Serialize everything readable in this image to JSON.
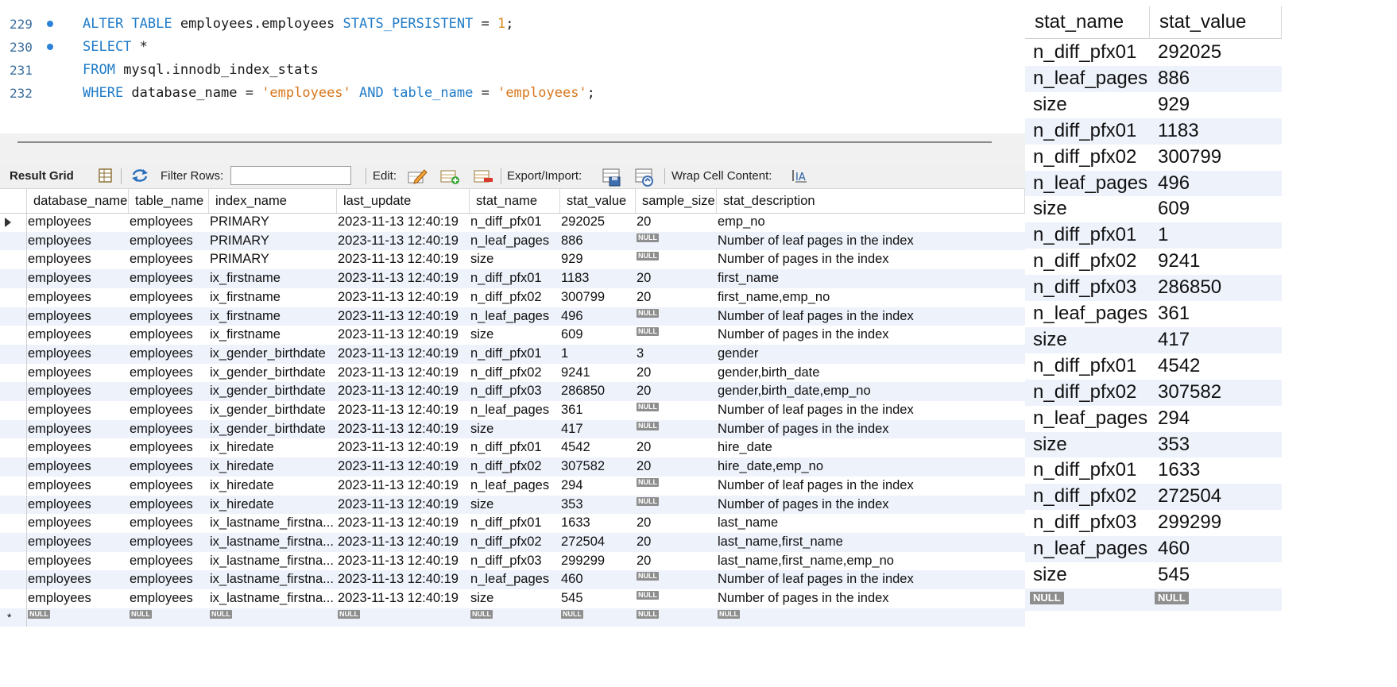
{
  "editor": {
    "lines": [
      {
        "num": "229",
        "dot": true,
        "segs": [
          {
            "t": "ALTER TABLE",
            "c": "kw"
          },
          {
            "t": " employees.employees ",
            "c": ""
          },
          {
            "t": "STATS_PERSISTENT",
            "c": "kw"
          },
          {
            "t": " = ",
            "c": ""
          },
          {
            "t": "1",
            "c": "num"
          },
          {
            "t": ";",
            "c": ""
          }
        ]
      },
      {
        "num": "230",
        "dot": true,
        "segs": [
          {
            "t": "SELECT",
            "c": "kw"
          },
          {
            "t": " *",
            "c": ""
          }
        ]
      },
      {
        "num": "231",
        "dot": false,
        "segs": [
          {
            "t": "FROM",
            "c": "kw"
          },
          {
            "t": " mysql.innodb_index_stats",
            "c": ""
          }
        ]
      },
      {
        "num": "232",
        "dot": false,
        "segs": [
          {
            "t": "WHERE",
            "c": "kw"
          },
          {
            "t": " database_name = ",
            "c": ""
          },
          {
            "t": "'employees'",
            "c": "str"
          },
          {
            "t": " ",
            "c": ""
          },
          {
            "t": "AND",
            "c": "kw"
          },
          {
            "t": " ",
            "c": ""
          },
          {
            "t": "table_name",
            "c": "kw"
          },
          {
            "t": " = ",
            "c": ""
          },
          {
            "t": "'employees'",
            "c": "str"
          },
          {
            "t": ";",
            "c": ""
          }
        ]
      }
    ]
  },
  "toolbar": {
    "result_grid": "Result Grid",
    "filter_rows": "Filter Rows:",
    "filter_value": "",
    "edit": "Edit:",
    "export_import": "Export/Import:",
    "wrap_cell": "Wrap Cell Content:"
  },
  "grid": {
    "columns": [
      "database_name",
      "table_name",
      "index_name",
      "last_update",
      "stat_name",
      "stat_value",
      "sample_size",
      "stat_description"
    ],
    "null_label": "NULL",
    "new_row_marker": "*",
    "rows": [
      [
        "employees",
        "employees",
        "PRIMARY",
        "2023-11-13 12:40:19",
        "n_diff_pfx01",
        "292025",
        "20",
        "emp_no"
      ],
      [
        "employees",
        "employees",
        "PRIMARY",
        "2023-11-13 12:40:19",
        "n_leaf_pages",
        "886",
        null,
        "Number of leaf pages in the index"
      ],
      [
        "employees",
        "employees",
        "PRIMARY",
        "2023-11-13 12:40:19",
        "size",
        "929",
        null,
        "Number of pages in the index"
      ],
      [
        "employees",
        "employees",
        "ix_firstname",
        "2023-11-13 12:40:19",
        "n_diff_pfx01",
        "1183",
        "20",
        "first_name"
      ],
      [
        "employees",
        "employees",
        "ix_firstname",
        "2023-11-13 12:40:19",
        "n_diff_pfx02",
        "300799",
        "20",
        "first_name,emp_no"
      ],
      [
        "employees",
        "employees",
        "ix_firstname",
        "2023-11-13 12:40:19",
        "n_leaf_pages",
        "496",
        null,
        "Number of leaf pages in the index"
      ],
      [
        "employees",
        "employees",
        "ix_firstname",
        "2023-11-13 12:40:19",
        "size",
        "609",
        null,
        "Number of pages in the index"
      ],
      [
        "employees",
        "employees",
        "ix_gender_birthdate",
        "2023-11-13 12:40:19",
        "n_diff_pfx01",
        "1",
        "3",
        "gender"
      ],
      [
        "employees",
        "employees",
        "ix_gender_birthdate",
        "2023-11-13 12:40:19",
        "n_diff_pfx02",
        "9241",
        "20",
        "gender,birth_date"
      ],
      [
        "employees",
        "employees",
        "ix_gender_birthdate",
        "2023-11-13 12:40:19",
        "n_diff_pfx03",
        "286850",
        "20",
        "gender,birth_date,emp_no"
      ],
      [
        "employees",
        "employees",
        "ix_gender_birthdate",
        "2023-11-13 12:40:19",
        "n_leaf_pages",
        "361",
        null,
        "Number of leaf pages in the index"
      ],
      [
        "employees",
        "employees",
        "ix_gender_birthdate",
        "2023-11-13 12:40:19",
        "size",
        "417",
        null,
        "Number of pages in the index"
      ],
      [
        "employees",
        "employees",
        "ix_hiredate",
        "2023-11-13 12:40:19",
        "n_diff_pfx01",
        "4542",
        "20",
        "hire_date"
      ],
      [
        "employees",
        "employees",
        "ix_hiredate",
        "2023-11-13 12:40:19",
        "n_diff_pfx02",
        "307582",
        "20",
        "hire_date,emp_no"
      ],
      [
        "employees",
        "employees",
        "ix_hiredate",
        "2023-11-13 12:40:19",
        "n_leaf_pages",
        "294",
        null,
        "Number of leaf pages in the index"
      ],
      [
        "employees",
        "employees",
        "ix_hiredate",
        "2023-11-13 12:40:19",
        "size",
        "353",
        null,
        "Number of pages in the index"
      ],
      [
        "employees",
        "employees",
        "ix_lastname_firstna...",
        "2023-11-13 12:40:19",
        "n_diff_pfx01",
        "1633",
        "20",
        "last_name"
      ],
      [
        "employees",
        "employees",
        "ix_lastname_firstna...",
        "2023-11-13 12:40:19",
        "n_diff_pfx02",
        "272504",
        "20",
        "last_name,first_name"
      ],
      [
        "employees",
        "employees",
        "ix_lastname_firstna...",
        "2023-11-13 12:40:19",
        "n_diff_pfx03",
        "299299",
        "20",
        "last_name,first_name,emp_no"
      ],
      [
        "employees",
        "employees",
        "ix_lastname_firstna...",
        "2023-11-13 12:40:19",
        "n_leaf_pages",
        "460",
        null,
        "Number of leaf pages in the index"
      ],
      [
        "employees",
        "employees",
        "ix_lastname_firstna...",
        "2023-11-13 12:40:19",
        "size",
        "545",
        null,
        "Number of pages in the index"
      ]
    ]
  },
  "right_panel": {
    "columns": [
      "stat_name",
      "stat_value"
    ],
    "rows": [
      [
        "n_diff_pfx01",
        "292025"
      ],
      [
        "n_leaf_pages",
        "886"
      ],
      [
        "size",
        "929"
      ],
      [
        "n_diff_pfx01",
        "1183"
      ],
      [
        "n_diff_pfx02",
        "300799"
      ],
      [
        "n_leaf_pages",
        "496"
      ],
      [
        "size",
        "609"
      ],
      [
        "n_diff_pfx01",
        "1"
      ],
      [
        "n_diff_pfx02",
        "9241"
      ],
      [
        "n_diff_pfx03",
        "286850"
      ],
      [
        "n_leaf_pages",
        "361"
      ],
      [
        "size",
        "417"
      ],
      [
        "n_diff_pfx01",
        "4542"
      ],
      [
        "n_diff_pfx02",
        "307582"
      ],
      [
        "n_leaf_pages",
        "294"
      ],
      [
        "size",
        "353"
      ],
      [
        "n_diff_pfx01",
        "1633"
      ],
      [
        "n_diff_pfx02",
        "272504"
      ],
      [
        "n_diff_pfx03",
        "299299"
      ],
      [
        "n_leaf_pages",
        "460"
      ],
      [
        "size",
        "545"
      ]
    ]
  }
}
